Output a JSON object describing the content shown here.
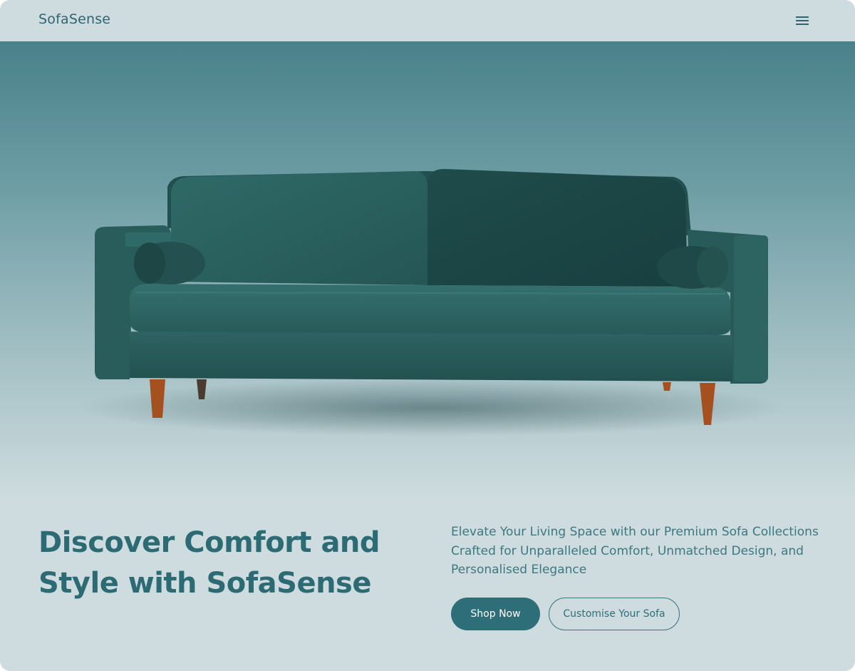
{
  "header": {
    "logo": "SofaSense",
    "menu_icon": "hamburger-menu-icon"
  },
  "hero": {
    "image": "teal-velvet-sofa",
    "colors": {
      "sofa": "#2a5e5d",
      "legs": "#a5511f",
      "top": "#4a818a"
    }
  },
  "main": {
    "title": "Discover Comfort and Style with SofaSense",
    "tagline": "Elevate Your Living Space with our Premium Sofa Collections Crafted for Unparalleled Comfort, Unmatched Design, and Personalised Elegance",
    "primary_button": "Shop Now",
    "secondary_button": "Customise Your Sofa"
  },
  "colors": {
    "background": "#cedcdf",
    "accent": "#2e6e78",
    "text": "#2c6b74"
  }
}
